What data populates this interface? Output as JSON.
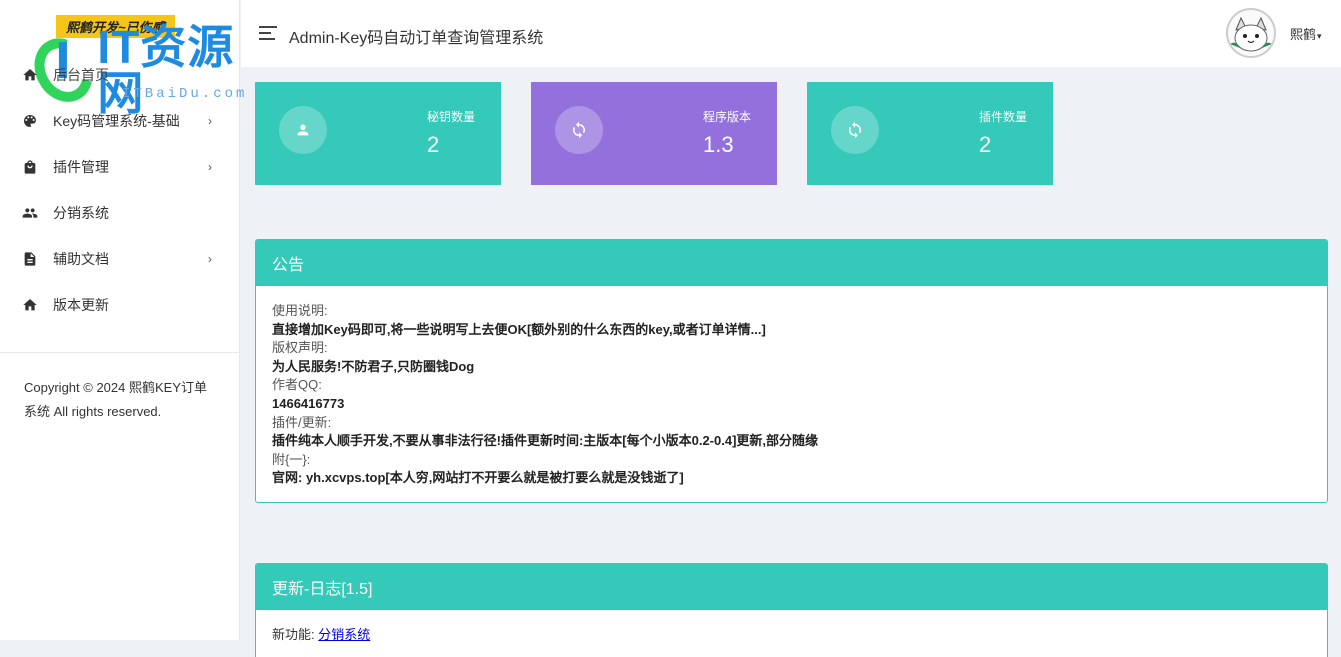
{
  "sidebar": {
    "badge": "熙鹤开发~已伤感",
    "watermark_logo": "IT资源网",
    "watermark_sub": "ITBaiDu.com",
    "items": [
      {
        "label": "后台首页",
        "icon": "home-icon",
        "chevron": ""
      },
      {
        "label": "Key码管理系统-基础",
        "icon": "palette-icon",
        "chevron": "›"
      },
      {
        "label": "插件管理",
        "icon": "bag-icon",
        "chevron": "›"
      },
      {
        "label": "分销系统",
        "icon": "people-icon",
        "chevron": ""
      },
      {
        "label": "辅助文档",
        "icon": "document-icon",
        "chevron": "›"
      },
      {
        "label": "版本更新",
        "icon": "home-icon",
        "chevron": ""
      }
    ],
    "copyright": "Copyright © 2024 熙鹤KEY订单系统 All rights reserved."
  },
  "header": {
    "title": "Admin-Key码自动订单查询管理系统",
    "username": "熙鹤",
    "caret": "▾"
  },
  "cards": [
    {
      "label": "秘钥数量",
      "value": "2",
      "color": "#34c9b8",
      "icon": "person-icon"
    },
    {
      "label": "程序版本",
      "value": "1.3",
      "color": "#9370db",
      "icon": "refresh-icon"
    },
    {
      "label": "插件数量",
      "value": "2",
      "color": "#34c9b8",
      "icon": "refresh-icon"
    }
  ],
  "notice": {
    "title": "公告",
    "lines": [
      {
        "label": "使用说明:",
        "text": "直接增加Key码即可,将一些说明写上去便OK[额外别的什么东西的key,或者订单详情...]"
      },
      {
        "label": "版权声明:",
        "text": "为人民服务!不防君子,只防圈钱Dog"
      },
      {
        "label": "作者QQ:",
        "text": "1466416773"
      },
      {
        "label": "插件/更新:",
        "text": "插件纯本人顺手开发,不要从事非法行径!插件更新时间:主版本[每个小版本0.2-0.4]更新,部分随缘"
      },
      {
        "label": "附{一}:",
        "text": "官网: yh.xcvps.top[本人穷,网站打不开要么就是被打要么就是没钱逝了]"
      }
    ]
  },
  "changelog": {
    "title": "更新-日志[1.5]",
    "prefix": "新功能: ",
    "link": "分销系统"
  },
  "colors": {
    "teal": "#34c9b8",
    "purple": "#9370db"
  }
}
